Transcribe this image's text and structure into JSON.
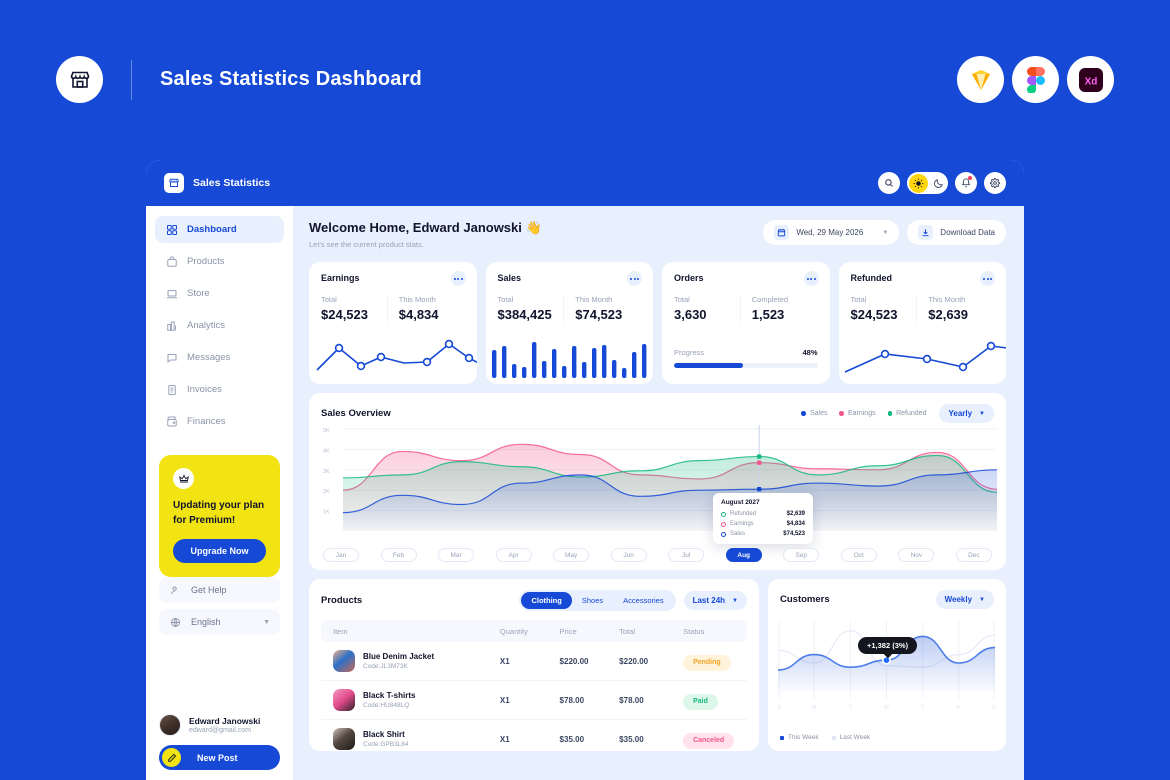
{
  "banner": {
    "title": "Sales Statistics Dashboard",
    "logo_icon": "storefront-icon",
    "badges": [
      {
        "name": "sketch-logo",
        "label": "Sketch"
      },
      {
        "name": "figma-logo",
        "label": "Figma"
      },
      {
        "name": "adobe-xd-logo",
        "label": "Xd"
      }
    ]
  },
  "topbar": {
    "title": "Sales Statistics",
    "logo_icon": "storefront-icon",
    "actions": [
      {
        "name": "search-icon",
        "label": "Search"
      },
      {
        "name": "theme-toggle",
        "label": "Light / Dark"
      },
      {
        "name": "notifications-icon",
        "label": "Notifications"
      },
      {
        "name": "settings-gear-icon",
        "label": "Settings"
      }
    ]
  },
  "sidebar": {
    "items": [
      {
        "label": "Dashboard",
        "icon": "dashboard-grid-icon",
        "active": true
      },
      {
        "label": "Products",
        "icon": "bag-icon",
        "active": false
      },
      {
        "label": "Store",
        "icon": "store-icon",
        "active": false
      },
      {
        "label": "Analytics",
        "icon": "bar-chart-icon",
        "active": false
      },
      {
        "label": "Messages",
        "icon": "message-icon",
        "active": false
      },
      {
        "label": "Invoices",
        "icon": "invoice-icon",
        "active": false
      },
      {
        "label": "Finances",
        "icon": "wallet-icon",
        "active": false
      }
    ],
    "promo": {
      "icon": "crown-icon",
      "text": "Updating your plan for Premium!",
      "button_label": "Upgrade Now"
    },
    "utilities": [
      {
        "label": "Get Help",
        "icon": "help-person-icon"
      },
      {
        "label": "English",
        "icon": "globe-icon",
        "caret": true
      }
    ],
    "profile": {
      "name": "Edward Janowski",
      "email": "edward@gmail.com"
    },
    "new_post_label": "New Post",
    "new_post_icon": "pencil-icon"
  },
  "main": {
    "welcome_title": "Welcome Home, Edward Janowski  👋",
    "welcome_subtitle": "Let's see the current product stats.",
    "date_picker": {
      "label": "Wed, 29 May 2026",
      "icon": "calendar-icon"
    },
    "download_button": {
      "label": "Download Data",
      "icon": "download-icon"
    }
  },
  "stats": [
    {
      "title": "Earnings",
      "col1_label": "Total",
      "col1_value": "$24,523",
      "col2_label": "This Month",
      "col2_value": "$4,834",
      "graph": "line"
    },
    {
      "title": "Sales",
      "col1_label": "Total",
      "col1_value": "$384,425",
      "col2_label": "This Month",
      "col2_value": "$74,523",
      "graph": "bars"
    },
    {
      "title": "Orders",
      "col1_label": "Total",
      "col1_value": "3,630",
      "col2_label": "Completed",
      "col2_value": "1,523",
      "graph": "progress",
      "progress_label": "Progress",
      "progress_pct": "48%",
      "progress_value": 48
    },
    {
      "title": "Refunded",
      "col1_label": "Total",
      "col1_value": "$24,523",
      "col2_label": "This Month",
      "col2_value": "$2,639",
      "graph": "line2"
    }
  ],
  "overview": {
    "title": "Sales Overview",
    "range_label": "Yearly",
    "tooltip": {
      "title": "August 2027",
      "rows": [
        {
          "label": "Refunded",
          "value": "$2,639",
          "color": "#15b87d"
        },
        {
          "label": "Earnings",
          "value": "$4,834",
          "color": "#f2568c"
        },
        {
          "label": "Sales",
          "value": "$74,523",
          "color": "#1549d6"
        }
      ]
    }
  },
  "products": {
    "title": "Products",
    "tabs": [
      {
        "label": "Clothing",
        "active": true
      },
      {
        "label": "Shoes",
        "active": false
      },
      {
        "label": "Accessories",
        "active": false
      }
    ],
    "range_label": "Last 24h",
    "columns": [
      "Item",
      "Quantity",
      "Price",
      "Total",
      "Status"
    ],
    "rows": [
      {
        "name": "Blue Denim Jacket",
        "code": "Code:JL3M73K",
        "qty": "X1",
        "price": "$220.00",
        "total": "$220.00",
        "status": "Pending",
        "status_kind": "pending",
        "thumb": "t1"
      },
      {
        "name": "Black T-shirts",
        "code": "Code:HU848LQ",
        "qty": "X1",
        "price": "$78.00",
        "total": "$78.00",
        "status": "Paid",
        "status_kind": "paid",
        "thumb": "t2"
      },
      {
        "name": "Black Shirt",
        "code": "Code:GPB3L84",
        "qty": "X1",
        "price": "$35.00",
        "total": "$35.00",
        "status": "Canceled",
        "status_kind": "canceled",
        "thumb": "t3"
      }
    ]
  },
  "customers": {
    "title": "Customers",
    "range_label": "Weekly",
    "tooltip": "+1,382 (3%)",
    "legend": [
      {
        "label": "This Week",
        "color": "#1549d6"
      },
      {
        "label": "Last Week",
        "color": "#dfe5f2"
      }
    ]
  },
  "colors": {
    "brand_blue": "#1549d6",
    "accent_yellow": "#f2e313",
    "pink": "#f2568c",
    "green": "#15b87d",
    "page_bg": "#e8effd"
  },
  "chart_data": {
    "overview": {
      "type": "area",
      "title": "Sales Overview",
      "categories": [
        "Jan",
        "Feb",
        "Mar",
        "Apr",
        "May",
        "Jun",
        "Jul",
        "Aug",
        "Sep",
        "Oct",
        "Nov",
        "Dec"
      ],
      "active_category": "Aug",
      "ylabel": "",
      "ytick_labels": [
        "1K",
        "2K",
        "3K",
        "4K",
        "5K"
      ],
      "ylim": [
        0,
        5000
      ],
      "grid": true,
      "legend_position": "top-right",
      "series": [
        {
          "name": "Sales",
          "color": "#1549d6",
          "values": [
            900,
            1750,
            1300,
            2350,
            2750,
            1700,
            2000,
            2050,
            2350,
            2200,
            2750,
            3000
          ]
        },
        {
          "name": "Earnings",
          "color": "#f2568c",
          "values": [
            2000,
            3900,
            3450,
            4250,
            3750,
            2750,
            2550,
            3350,
            3050,
            3000,
            3850,
            2050
          ]
        },
        {
          "name": "Refunded",
          "color": "#15b87d",
          "values": [
            2600,
            2750,
            3400,
            3150,
            2650,
            2950,
            3450,
            3650,
            2750,
            3200,
            3700,
            1900
          ]
        }
      ]
    },
    "earnings_spark": {
      "type": "line",
      "color": "#1549d6",
      "values": [
        18,
        42,
        64,
        22,
        50,
        36,
        38,
        66,
        40,
        20
      ]
    },
    "sales_bars": {
      "type": "bar",
      "color": "#1549d6",
      "values": [
        60,
        70,
        30,
        25,
        78,
        38,
        62,
        26,
        70,
        36,
        66,
        72,
        40,
        22,
        58,
        74
      ]
    },
    "refunded_spark": {
      "type": "line",
      "color": "#1549d6",
      "values": [
        12,
        55,
        46,
        30,
        70,
        66
      ]
    },
    "customers": {
      "type": "area",
      "title": "Customers",
      "categories": [
        "S",
        "M",
        "T",
        "W",
        "T",
        "F",
        "S"
      ],
      "grid": true,
      "series": [
        {
          "name": "This Week",
          "color": "#1549d6",
          "values": [
            30,
            52,
            34,
            44,
            78,
            40,
            62
          ]
        },
        {
          "name": "Last Week",
          "color": "#dfe5f2",
          "values": [
            58,
            40,
            86,
            36,
            34,
            52,
            80
          ]
        }
      ],
      "annotation": {
        "label": "+1,382 (3%)",
        "at_category": "W"
      }
    }
  }
}
